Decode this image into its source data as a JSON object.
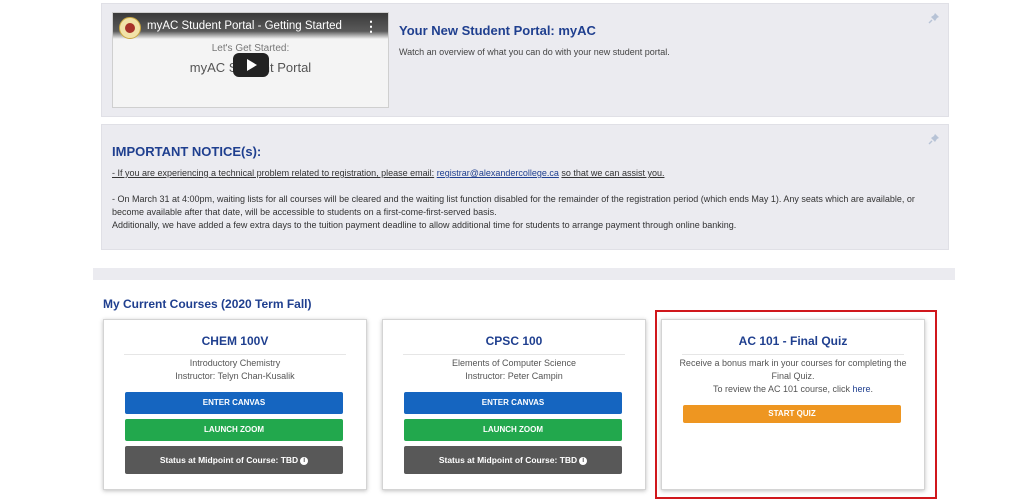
{
  "video_panel": {
    "video_title": "myAC Student Portal - Getting Started",
    "video_subtitle_1": "Let's Get Started:",
    "video_subtitle_2": "myAC Student Portal",
    "heading": "Your New Student Portal: myAC",
    "description": "Watch an overview of what you can do with your new student portal."
  },
  "notice": {
    "heading": "IMPORTANT NOTICE(s):",
    "line1_prefix": "- If you are experiencing a technical problem related to registration, please email:",
    "email": "registrar@alexandercollege.ca",
    "line1_suffix": "so that we can assist you.",
    "paragraph2": "- On March 31 at 4:00pm, waiting lists for all courses will be cleared and the waiting list function disabled for the remainder of the registration period (which ends May 1). Any seats which are available, or become available after that date, will be accessible to students on a first-come-first-served basis.",
    "paragraph3": "Additionally, we have added a few extra days to the tuition payment deadline to allow additional time for students to arrange payment through online banking."
  },
  "courses": {
    "section_title": "My Current Courses (2020 Term Fall)",
    "cards": [
      {
        "code": "CHEM 100V",
        "name": "Introductory Chemistry",
        "instructor": "Instructor: Telyn Chan-Kusalik",
        "enter_canvas": "ENTER CANVAS",
        "launch_zoom": "LAUNCH ZOOM",
        "status": "Status at Midpoint of Course: TBD"
      },
      {
        "code": "CPSC 100",
        "name": "Elements of Computer Science",
        "instructor": "Instructor: Peter Campin",
        "enter_canvas": "ENTER CANVAS",
        "launch_zoom": "LAUNCH ZOOM",
        "status": "Status at Midpoint of Course: TBD"
      }
    ],
    "quiz_card": {
      "title": "AC 101 - Final Quiz",
      "desc_line1": "Receive a bonus mark in your courses for completing the",
      "desc_line2": "Final Quiz.",
      "review_prefix": "To review the AC 101 course, click",
      "review_link": "here",
      "review_suffix": ".",
      "button": "START QUIZ"
    }
  },
  "colors": {
    "accent": "#1f3f8f",
    "blue_button": "#1565c0",
    "green_button": "#22a84d",
    "gray_button": "#585858",
    "orange_button": "#ee9621",
    "highlight": "#d0171c"
  },
  "icons": [
    "pin-icon",
    "play-icon",
    "info-icon",
    "more-vert-icon"
  ]
}
